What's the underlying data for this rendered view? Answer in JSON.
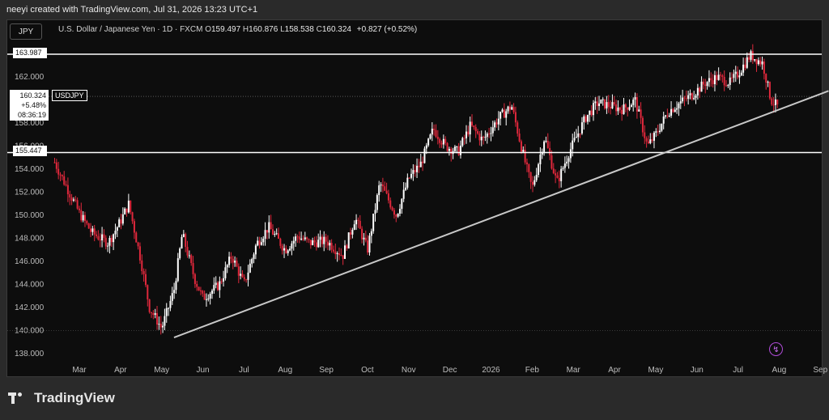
{
  "header": {
    "created_by": "neeyi created with TradingView.com, Jul 31, 2026 13:23 UTC+1"
  },
  "symbol_box": "JPY",
  "legend": {
    "description": "U.S. Dollar / Japanese Yen · 1D · FXCM",
    "open_label": "O",
    "open": "159.497",
    "high_label": "H",
    "high": "160.876",
    "low_label": "L",
    "low": "158.538",
    "close_label": "C",
    "close": "160.324",
    "change": "+0.827 (+0.52%)"
  },
  "price_panel": {
    "price": "160.324",
    "percent": "+5.48%",
    "countdown": "08:36:19",
    "symbol": "USDJPY"
  },
  "levels": {
    "upper": "163.987",
    "lower": "155.447"
  },
  "footer": {
    "brand": "TradingView"
  },
  "colors": {
    "up": "#ffffff",
    "down": "#e0283c",
    "background": "#0d0d0d",
    "trendline": "#c8c8c8",
    "level": "#ffffff"
  },
  "chart_data": {
    "type": "candlestick",
    "title": "",
    "ylim": [
      137.5,
      165.0
    ],
    "yticks": [
      138,
      140,
      142,
      144,
      146,
      148,
      150,
      152,
      154,
      156,
      158,
      160,
      162
    ],
    "ytick_labels": [
      "138.000",
      "140.000",
      "142.000",
      "144.000",
      "146.000",
      "148.000",
      "150.000",
      "152.000",
      "154.000",
      "156.000",
      "158.000",
      "160.000",
      "162.000"
    ],
    "xticks": [
      "Mar",
      "Apr",
      "May",
      "Jun",
      "Jul",
      "Aug",
      "Sep",
      "Oct",
      "Nov",
      "Dec",
      "2026",
      "Feb",
      "Mar",
      "Apr",
      "May",
      "Jun",
      "Jul",
      "Aug",
      "Sep"
    ],
    "horizontal_lines": [
      163.987,
      155.447
    ],
    "dotted_line": 160.324,
    "grid_line": 140.0,
    "trendline": {
      "from": {
        "month_index": 2.3,
        "value": 139.4
      },
      "to": {
        "month_index": 18.2,
        "value": 160.8
      }
    },
    "price_path_month_index": [
      -0.6,
      0.0,
      0.3,
      0.7,
      1.0,
      1.2,
      1.5,
      1.7,
      2.0,
      2.3,
      2.5,
      2.8,
      3.0,
      3.4,
      3.7,
      4.0,
      4.3,
      4.6,
      5.0,
      5.3,
      5.6,
      6.0,
      6.4,
      6.7,
      7.0,
      7.3,
      7.7,
      8.0,
      8.3,
      8.6,
      8.9,
      9.2,
      9.5,
      9.8,
      10.2,
      10.5,
      10.8,
      11.0,
      11.3,
      11.6,
      11.9,
      12.3,
      12.6,
      12.9,
      13.2,
      13.5,
      13.8,
      14.0,
      14.3,
      14.6,
      14.9,
      15.2,
      15.5,
      15.8,
      16.0,
      16.3,
      16.6,
      16.8,
      17.0
    ],
    "price_path_close": [
      154.6,
      150.2,
      148.5,
      147.6,
      149.5,
      151.0,
      146.0,
      142.0,
      140.2,
      143.5,
      148.4,
      144.5,
      142.8,
      144.0,
      146.5,
      144.0,
      147.5,
      149.0,
      147.0,
      148.2,
      147.6,
      147.8,
      146.5,
      149.8,
      147.0,
      152.8,
      150.0,
      153.2,
      154.5,
      157.5,
      156.0,
      155.5,
      157.8,
      156.5,
      158.5,
      159.5,
      155.0,
      152.3,
      156.8,
      152.8,
      155.5,
      158.5,
      159.8,
      159.5,
      159.2,
      160.0,
      156.0,
      157.0,
      159.0,
      159.8,
      160.5,
      161.5,
      162.0,
      161.5,
      162.3,
      163.9,
      163.2,
      160.0,
      159.3
    ],
    "last_close": 160.324
  }
}
